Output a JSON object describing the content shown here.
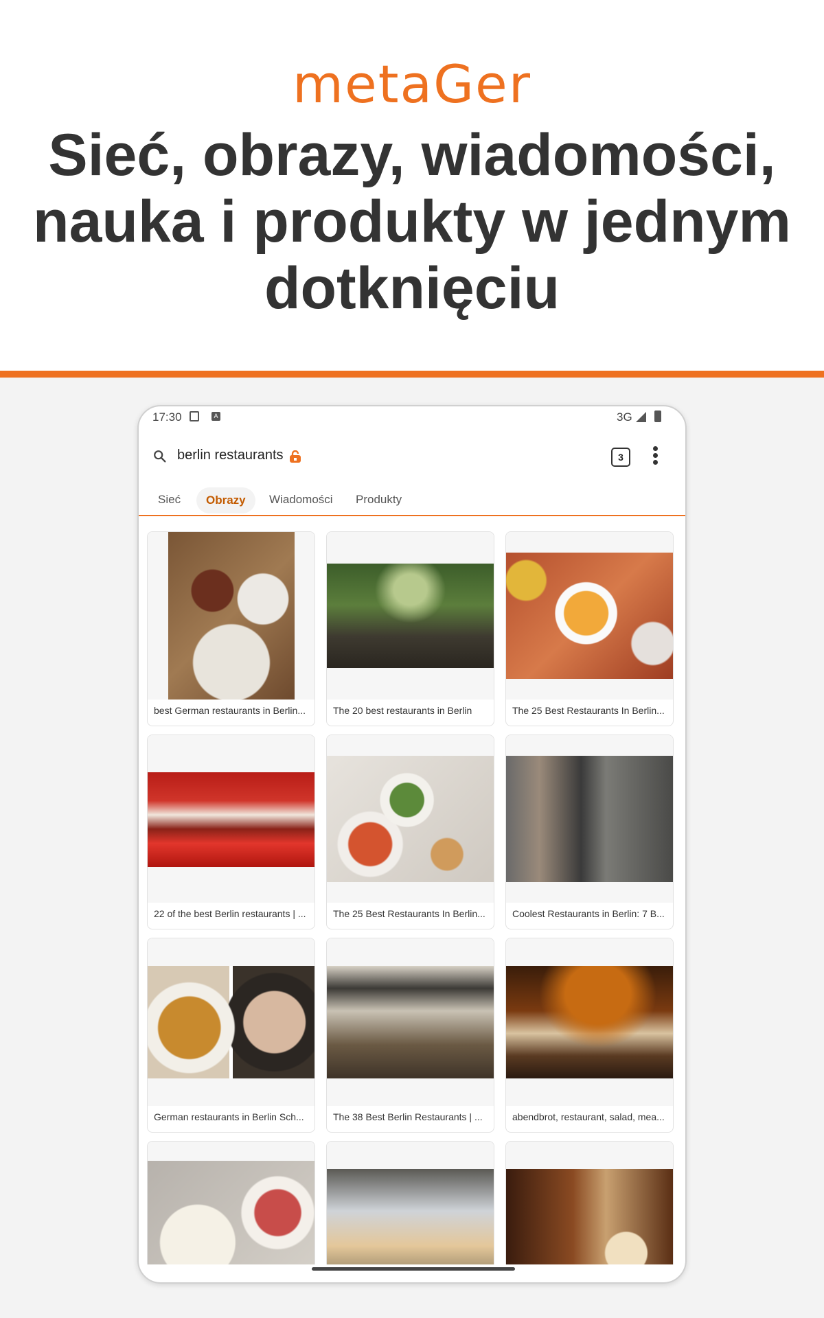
{
  "brand": {
    "logo_text": "metaGer",
    "headline": "Sieć, obrazy, wiadomości, nauka i produkty w jednym dotknięciu",
    "accent_color": "#ee7120"
  },
  "status_bar": {
    "time": "17:30",
    "network": "3G"
  },
  "search": {
    "query": "berlin restaurants",
    "tab_count": "3"
  },
  "tabs": [
    {
      "label": "Sieć",
      "active": false
    },
    {
      "label": "Obrazy",
      "active": true
    },
    {
      "label": "Wiadomości",
      "active": false
    },
    {
      "label": "Produkty",
      "active": false
    }
  ],
  "results": [
    {
      "caption": "best German restaurants in Berlin..."
    },
    {
      "caption": "The 20 best restaurants in Berlin"
    },
    {
      "caption": "The 25 Best Restaurants In Berlin..."
    },
    {
      "caption": "22 of the best Berlin restaurants | ..."
    },
    {
      "caption": "The 25 Best Restaurants In Berlin..."
    },
    {
      "caption": "Coolest Restaurants in Berlin: 7 B..."
    },
    {
      "caption": "German restaurants in Berlin Sch..."
    },
    {
      "caption": "The 38 Best Berlin Restaurants | ..."
    },
    {
      "caption": "abendbrot, restaurant, salad, mea..."
    },
    {
      "caption": ""
    },
    {
      "caption": ""
    },
    {
      "caption": ""
    }
  ]
}
